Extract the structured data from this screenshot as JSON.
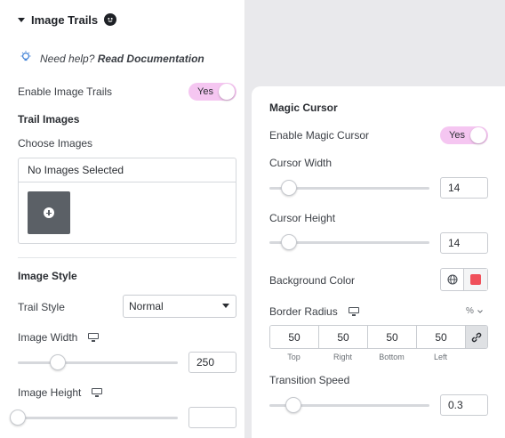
{
  "left": {
    "header": {
      "title": "Image Trails"
    },
    "help": {
      "question": "Need help?",
      "link": "Read Documentation"
    },
    "enable": {
      "label": "Enable Image Trails",
      "toggle": "Yes"
    },
    "trail_images": {
      "heading": "Trail Images",
      "choose_label": "Choose Images",
      "empty_text": "No Images Selected"
    },
    "image_style": {
      "heading": "Image Style",
      "trail_style": {
        "label": "Trail Style",
        "value": "Normal"
      },
      "image_width": {
        "label": "Image Width",
        "value": "250",
        "slider_fraction": 0.25
      },
      "image_height": {
        "label": "Image Height",
        "value": "",
        "slider_fraction": 0.0
      }
    }
  },
  "right": {
    "heading": "Magic Cursor",
    "enable": {
      "label": "Enable Magic Cursor",
      "toggle": "Yes"
    },
    "cursor_width": {
      "label": "Cursor Width",
      "value": "14",
      "slider_fraction": 0.12
    },
    "cursor_height": {
      "label": "Cursor Height",
      "value": "14",
      "slider_fraction": 0.12
    },
    "background_color": {
      "label": "Background Color",
      "swatch": "#f0505a"
    },
    "border_radius": {
      "label": "Border Radius",
      "unit": "%",
      "values": {
        "top": "50",
        "right": "50",
        "bottom": "50",
        "left": "50"
      },
      "sub_labels": {
        "top": "Top",
        "right": "Right",
        "bottom": "Bottom",
        "left": "Left"
      }
    },
    "transition_speed": {
      "label": "Transition Speed",
      "value": "0.3",
      "slider_fraction": 0.15
    }
  },
  "colors": {
    "toggle_bg": "#f5c6f1",
    "panel_bg": "#ffffff",
    "page_bg": "#e9e9ec"
  }
}
